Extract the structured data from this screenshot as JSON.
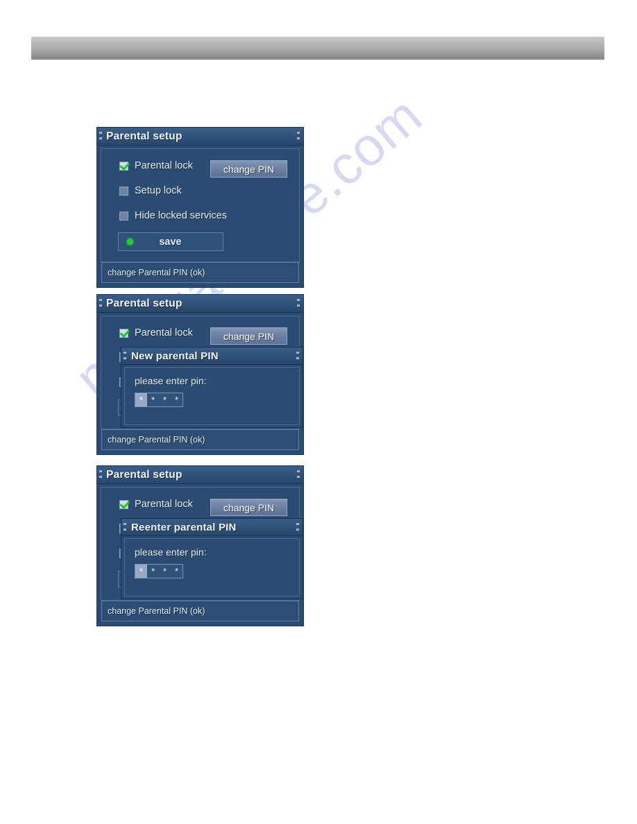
{
  "document": {
    "header_bar": {
      "type": "decorative-gray-gradient-bar",
      "text": ""
    },
    "watermark": {
      "text": "manualshive.com",
      "color": "#4850be"
    }
  },
  "theme": {
    "panel_background": "#2b4c72",
    "title_background": "#325479",
    "border": "#4a6c96",
    "text": "#e7edf5",
    "check_green": "#18c81c",
    "status_dot_green": "#1fd61f",
    "button_background": "#6d81a3"
  },
  "panels": [
    {
      "id": "parental-setup-main",
      "title": "Parental setup",
      "checkboxes": [
        {
          "label": "Parental lock",
          "checked": true
        },
        {
          "label": "Setup lock",
          "checked": false
        },
        {
          "label": "Hide locked services",
          "checked": false
        }
      ],
      "change_pin_button": "change PIN",
      "save_button": "save",
      "statusbar": "change Parental PIN (ok)",
      "subdialog": null
    },
    {
      "id": "parental-setup-new-pin",
      "title": "Parental setup",
      "checkboxes": [
        {
          "label": "Parental lock",
          "checked": true
        }
      ],
      "change_pin_button": "change PIN",
      "statusbar": "change Parental PIN (ok)",
      "subdialog": {
        "title": "New parental PIN",
        "prompt": "please enter pin:",
        "pin_cells": [
          "*",
          "*",
          "*",
          "*"
        ],
        "active_cell_index": 0
      }
    },
    {
      "id": "parental-setup-reenter-pin",
      "title": "Parental setup",
      "checkboxes": [
        {
          "label": "Parental lock",
          "checked": true
        }
      ],
      "change_pin_button": "change PIN",
      "statusbar": "change Parental PIN (ok)",
      "subdialog": {
        "title": "Reenter parental PIN",
        "prompt": "please enter pin:",
        "pin_cells": [
          "*",
          "*",
          "*",
          "*"
        ],
        "active_cell_index": 0
      }
    }
  ]
}
